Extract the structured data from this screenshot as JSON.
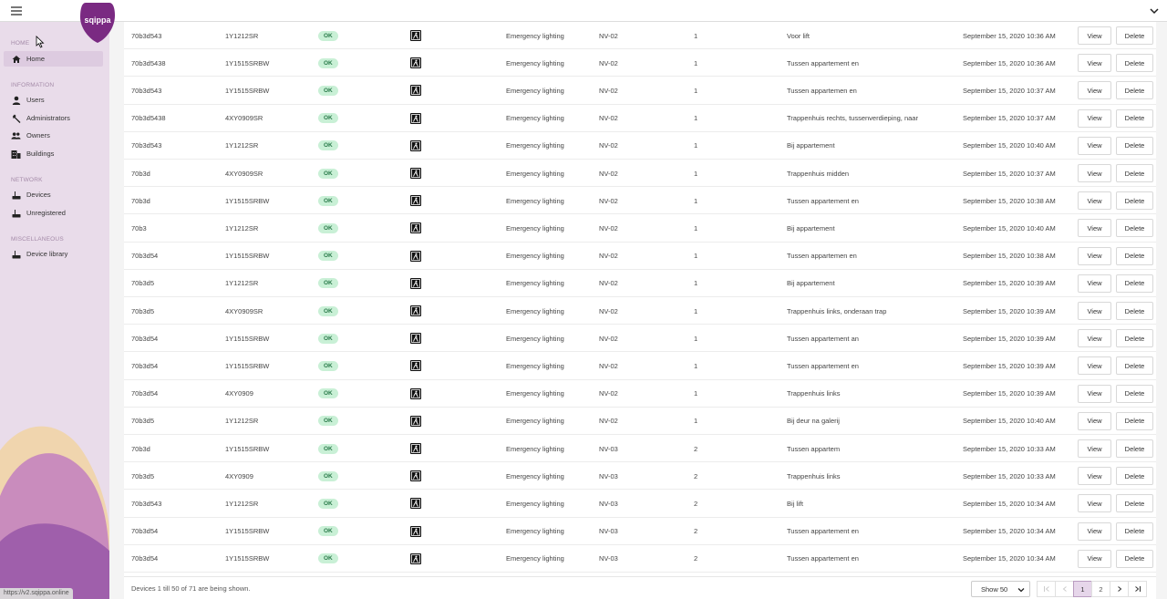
{
  "app": {
    "logo_text": "sqippa",
    "status_url": "https://v2.sqippa.online"
  },
  "colors": {
    "brand": "#7a2a82",
    "sidebar_bg": "#e9dcea",
    "ok_badge_bg": "#c9f0d6",
    "ok_badge_text": "#2a7a4a",
    "active_page": "#e6d6ea"
  },
  "sidebar": {
    "sections": [
      {
        "label": "HOME",
        "items": [
          {
            "label": "Home",
            "icon": "home-icon",
            "active": true
          }
        ]
      },
      {
        "label": "INFORMATION",
        "items": [
          {
            "label": "Users",
            "icon": "user-icon"
          },
          {
            "label": "Administrators",
            "icon": "wrench-icon"
          },
          {
            "label": "Owners",
            "icon": "users-icon"
          },
          {
            "label": "Buildings",
            "icon": "building-icon"
          }
        ]
      },
      {
        "label": "NETWORK",
        "items": [
          {
            "label": "Devices",
            "icon": "router-icon"
          },
          {
            "label": "Unregistered",
            "icon": "router-icon"
          }
        ]
      },
      {
        "label": "MISCELLANEOUS",
        "items": [
          {
            "label": "Device library",
            "icon": "router-icon"
          }
        ]
      }
    ]
  },
  "table": {
    "view_label": "View",
    "delete_label": "Delete",
    "rows": [
      {
        "id": "70b3d543",
        "type": "1Y1212SR",
        "status": "OK",
        "icon": "emergency-exit-icon",
        "category": "Emergency lighting",
        "location": "NV-02",
        "floor": "1",
        "description": "Voor lift",
        "date": "September 15, 2020 10:36 AM"
      },
      {
        "id": "70b3d5438",
        "type": "1Y1515SRBW",
        "status": "OK",
        "icon": "emergency-exit-icon",
        "category": "Emergency lighting",
        "location": "NV-02",
        "floor": "1",
        "description": "Tussen appartement       en",
        "date": "September 15, 2020 10:36 AM"
      },
      {
        "id": "70b3d543",
        "type": "1Y1515SRBW",
        "status": "OK",
        "icon": "emergency-exit-icon",
        "category": "Emergency lighting",
        "location": "NV-02",
        "floor": "1",
        "description": "Tussen appartemen       en",
        "date": "September 15, 2020 10:37 AM"
      },
      {
        "id": "70b3d5438",
        "type": "4XY0909SR",
        "status": "OK",
        "icon": "emergency-exit-icon",
        "category": "Emergency lighting",
        "location": "NV-02",
        "floor": "1",
        "description": "Trappenhuis rechts, tussenverdieping,    naar",
        "date": "September 15, 2020 10:37 AM"
      },
      {
        "id": "70b3d543",
        "type": "1Y1212SR",
        "status": "OK",
        "icon": "emergency-exit-icon",
        "category": "Emergency lighting",
        "location": "NV-02",
        "floor": "1",
        "description": "Bij appartement",
        "date": "September 15, 2020 10:40 AM"
      },
      {
        "id": "70b3d",
        "type": "4XY0909SR",
        "status": "OK",
        "icon": "emergency-exit-icon",
        "category": "Emergency lighting",
        "location": "NV-02",
        "floor": "1",
        "description": "Trappenhuis midden",
        "date": "September 15, 2020 10:37 AM"
      },
      {
        "id": "70b3d",
        "type": "1Y1515SRBW",
        "status": "OK",
        "icon": "emergency-exit-icon",
        "category": "Emergency lighting",
        "location": "NV-02",
        "floor": "1",
        "description": "Tussen appartement       en",
        "date": "September 15, 2020 10:38 AM"
      },
      {
        "id": "70b3",
        "type": "1Y1212SR",
        "status": "OK",
        "icon": "emergency-exit-icon",
        "category": "Emergency lighting",
        "location": "NV-02",
        "floor": "1",
        "description": "Bij appartement",
        "date": "September 15, 2020 10:40 AM"
      },
      {
        "id": "70b3d54",
        "type": "1Y1515SRBW",
        "status": "OK",
        "icon": "emergency-exit-icon",
        "category": "Emergency lighting",
        "location": "NV-02",
        "floor": "1",
        "description": "Tussen appartemen       en",
        "date": "September 15, 2020 10:38 AM"
      },
      {
        "id": "70b3d5",
        "type": "1Y1212SR",
        "status": "OK",
        "icon": "emergency-exit-icon",
        "category": "Emergency lighting",
        "location": "NV-02",
        "floor": "1",
        "description": "Bij appartement",
        "date": "September 15, 2020 10:39 AM"
      },
      {
        "id": "70b3d5",
        "type": "4XY0909SR",
        "status": "OK",
        "icon": "emergency-exit-icon",
        "category": "Emergency lighting",
        "location": "NV-02",
        "floor": "1",
        "description": "Trappenhuis links, onderaan trap",
        "date": "September 15, 2020 10:39 AM"
      },
      {
        "id": "70b3d54",
        "type": "1Y1515SRBW",
        "status": "OK",
        "icon": "emergency-exit-icon",
        "category": "Emergency lighting",
        "location": "NV-02",
        "floor": "1",
        "description": "Tussen appartement       an",
        "date": "September 15, 2020 10:39 AM"
      },
      {
        "id": "70b3d54",
        "type": "1Y1515SRBW",
        "status": "OK",
        "icon": "emergency-exit-icon",
        "category": "Emergency lighting",
        "location": "NV-02",
        "floor": "1",
        "description": "Tussen appartement       en",
        "date": "September 15, 2020 10:39 AM"
      },
      {
        "id": "70b3d54",
        "type": "4XY0909",
        "status": "OK",
        "icon": "emergency-exit-icon",
        "category": "Emergency lighting",
        "location": "NV-02",
        "floor": "1",
        "description": "Trappenhuis links",
        "date": "September 15, 2020 10:39 AM"
      },
      {
        "id": "70b3d5",
        "type": "1Y1212SR",
        "status": "OK",
        "icon": "emergency-exit-icon",
        "category": "Emergency lighting",
        "location": "NV-02",
        "floor": "1",
        "description": "Bij deur na galerij",
        "date": "September 15, 2020 10:40 AM"
      },
      {
        "id": "70b3d",
        "type": "1Y1515SRBW",
        "status": "OK",
        "icon": "emergency-exit-icon",
        "category": "Emergency lighting",
        "location": "NV-03",
        "floor": "2",
        "description": "Tussen appartem",
        "date": "September 15, 2020 10:33 AM"
      },
      {
        "id": "70b3d5",
        "type": "4XY0909",
        "status": "OK",
        "icon": "emergency-exit-icon",
        "category": "Emergency lighting",
        "location": "NV-03",
        "floor": "2",
        "description": "Trappenhuis links",
        "date": "September 15, 2020 10:33 AM"
      },
      {
        "id": "70b3d543",
        "type": "1Y1212SR",
        "status": "OK",
        "icon": "emergency-exit-icon",
        "category": "Emergency lighting",
        "location": "NV-03",
        "floor": "2",
        "description": "Bij lift",
        "date": "September 15, 2020 10:34 AM"
      },
      {
        "id": "70b3d54",
        "type": "1Y1515SRBW",
        "status": "OK",
        "icon": "emergency-exit-icon",
        "category": "Emergency lighting",
        "location": "NV-03",
        "floor": "2",
        "description": "Tussen appartement       en",
        "date": "September 15, 2020 10:34 AM"
      },
      {
        "id": "70b3d54",
        "type": "1Y1515SRBW",
        "status": "OK",
        "icon": "emergency-exit-icon",
        "category": "Emergency lighting",
        "location": "NV-03",
        "floor": "2",
        "description": "Tussen appartement       en",
        "date": "September 15, 2020 10:34 AM"
      }
    ]
  },
  "footer": {
    "summary": "Devices 1 till 50 of 71 are being shown.",
    "page_size": "Show 50",
    "pages": [
      "1",
      "2"
    ],
    "current_page": "1"
  }
}
